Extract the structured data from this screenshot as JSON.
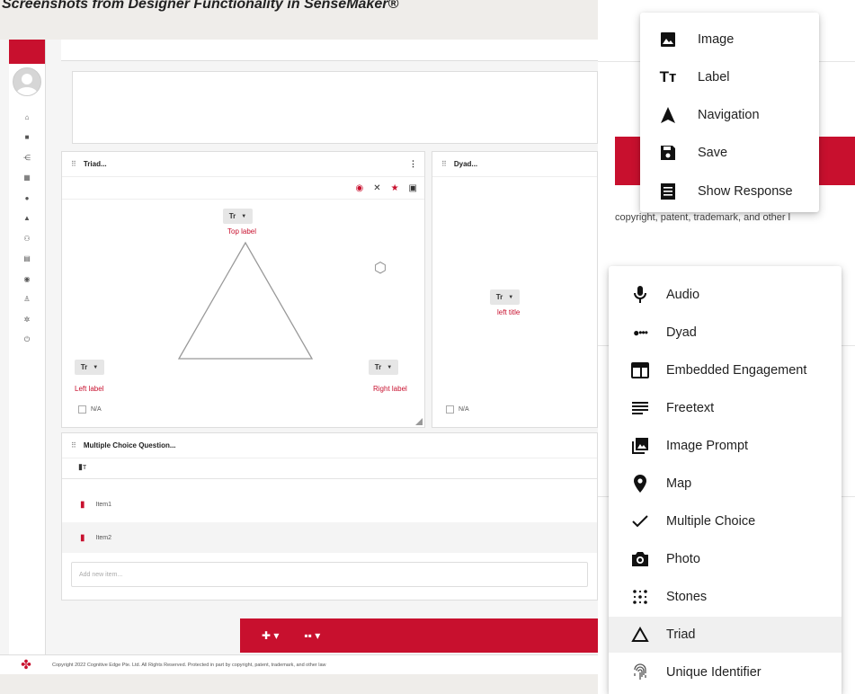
{
  "caption": "Screenshots from Designer Functionality in SenseMaker®",
  "designer": {
    "triad_panel": {
      "title": "Triad...",
      "menu": "⋮",
      "text_button": "Tr",
      "top_label": "Top label",
      "left_label": "Left label",
      "right_label": "Right label",
      "na": "N/A"
    },
    "dyad_panel": {
      "title": "Dyad...",
      "text_button": "Tr",
      "left_title": "left title",
      "na": "N/A"
    },
    "mcq_panel": {
      "title": "Multiple Choice Question...",
      "items": [
        "Item1",
        "Item2"
      ],
      "add_placeholder": "Add new item..."
    },
    "footer": "Copyright 2022 Cognitive Edge Pte. Ltd. All Rights Reserved. Protected in part by copyright, patent, trademark, and other law"
  },
  "right_bg_copy": "copyright, patent, trademark, and other l",
  "menu_top": {
    "items": [
      {
        "icon": "image-icon",
        "label": "Image"
      },
      {
        "icon": "text-label-icon",
        "label": "Label"
      },
      {
        "icon": "navigation-icon",
        "label": "Navigation"
      },
      {
        "icon": "save-icon",
        "label": "Save"
      },
      {
        "icon": "show-response-icon",
        "label": "Show Response"
      }
    ]
  },
  "menu_bottom": {
    "selected": "Triad",
    "items": [
      {
        "icon": "microphone-icon",
        "label": "Audio"
      },
      {
        "icon": "dyad-icon",
        "label": "Dyad"
      },
      {
        "icon": "embedded-engagement-icon",
        "label": "Embedded Engagement"
      },
      {
        "icon": "freetext-icon",
        "label": "Freetext"
      },
      {
        "icon": "image-prompt-icon",
        "label": "Image Prompt"
      },
      {
        "icon": "map-pin-icon",
        "label": "Map"
      },
      {
        "icon": "checkmark-icon",
        "label": "Multiple Choice"
      },
      {
        "icon": "camera-icon",
        "label": "Photo"
      },
      {
        "icon": "stones-icon",
        "label": "Stones"
      },
      {
        "icon": "triangle-icon",
        "label": "Triad"
      },
      {
        "icon": "fingerprint-icon",
        "label": "Unique Identifier"
      }
    ]
  },
  "colors": {
    "accent": "#c8102e"
  }
}
